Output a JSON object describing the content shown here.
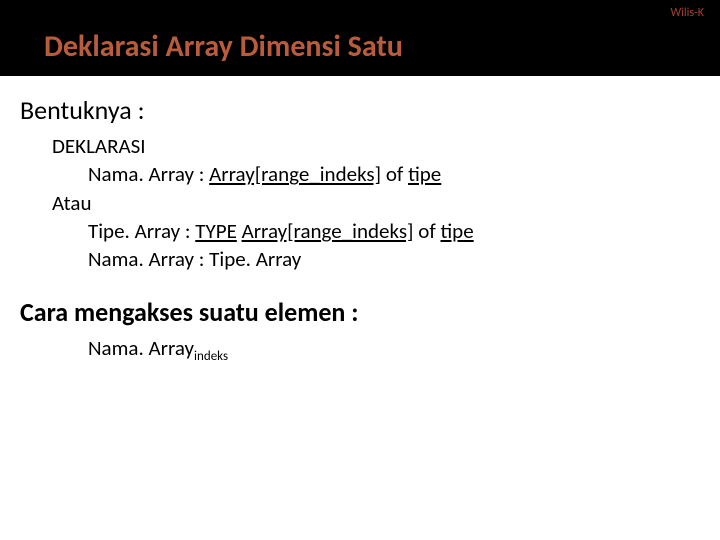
{
  "header": {
    "author": "Wilis-K",
    "title": "Deklarasi Array Dimensi Satu"
  },
  "body": {
    "section1_label": "Bentuknya :",
    "decl_label": "DEKLARASI",
    "line1_a": "Nama. Array : ",
    "line1_b": "Array[range_indeks]",
    "line1_c": " of ",
    "line1_d": "tipe",
    "atau": "Atau",
    "line2_a": "Tipe. Array : ",
    "line2_b": "TYPE",
    "line2_c": " ",
    "line2_d": "Array[range_indeks]",
    "line2_e": " of ",
    "line2_f": "tipe",
    "line3": "Nama. Array : Tipe. Array",
    "section2_label": "Cara mengakses suatu elemen :",
    "access_main": "Nama. Array",
    "access_sub": "indeks"
  }
}
